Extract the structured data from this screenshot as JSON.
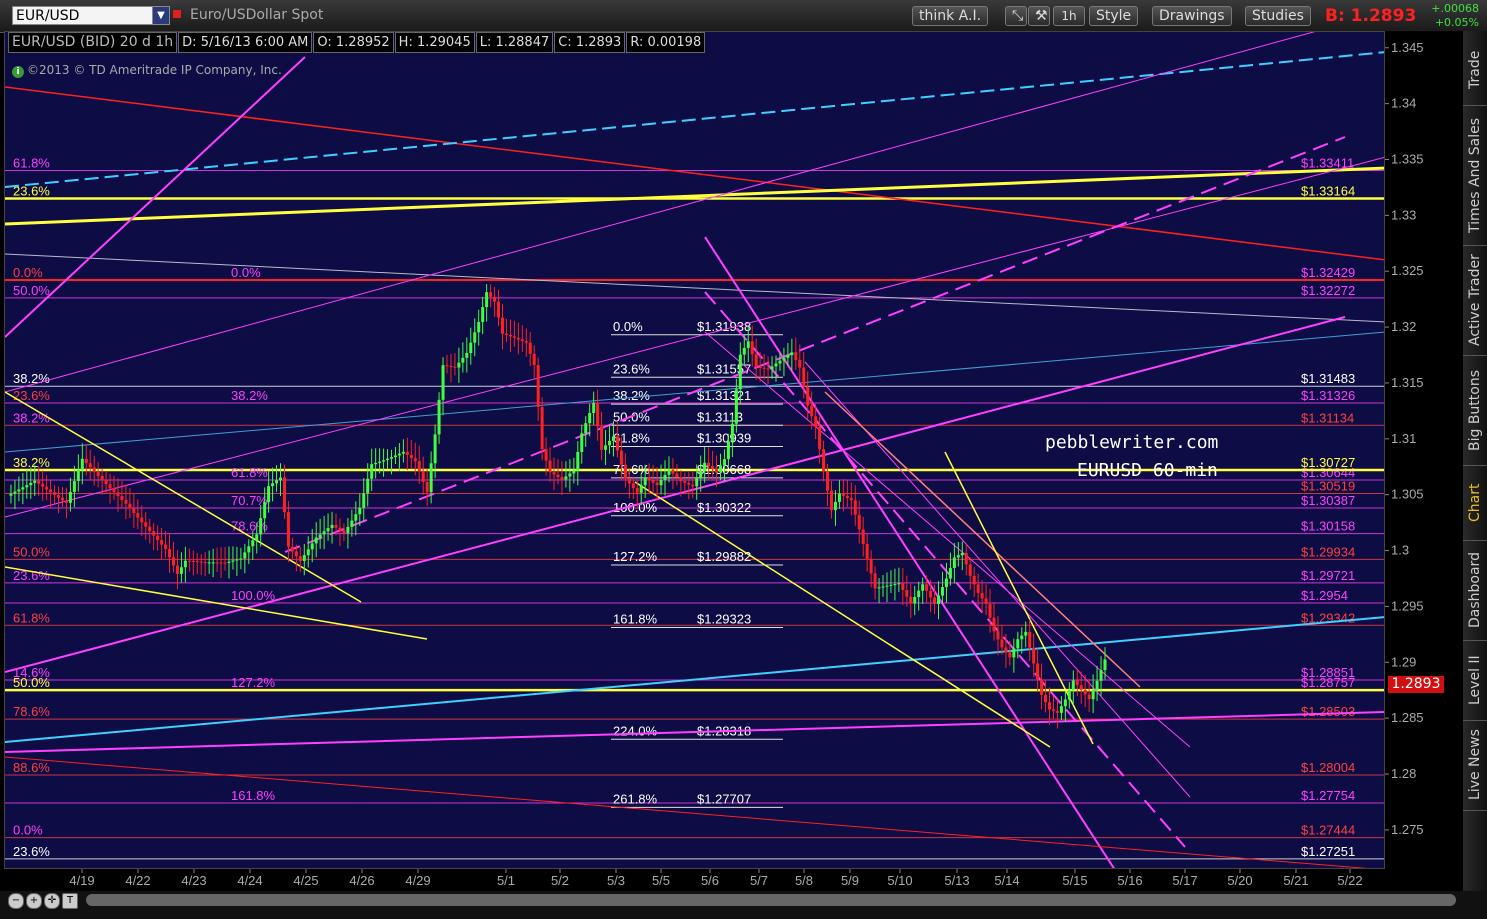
{
  "toolbar": {
    "symbol": "EUR/USD",
    "description": "Euro/USDollar Spot",
    "think_ai": "think A.I.",
    "period": "1h",
    "style": "Style",
    "drawings": "Drawings",
    "studies": "Studies",
    "bid_label": "B: 1.2893",
    "change": "+.00068",
    "change_pct": "+0.05%"
  },
  "header": {
    "title": "EUR/USD (BID) 20 d 1h",
    "date": "D: 5/16/13 6:00 AM",
    "open": "O: 1.28952",
    "high": "H: 1.29045",
    "low": "L: 1.28847",
    "close": "C: 1.2893",
    "range": "R: 0.00198"
  },
  "copyright": "©2013 © TD Ameritrade IP Company, Inc.",
  "side_tabs": [
    "Trade",
    "Times And Sales",
    "Active Trader",
    "Big Buttons",
    "Chart",
    "Dashboard",
    "Level II",
    "Live News"
  ],
  "colors": {
    "background": "#0d0c45",
    "up_candle": "#40ff40",
    "down_candle": "#ff2020",
    "fib_yellow": "#ffff40",
    "fib_magenta": "#ff40ff",
    "fib_red": "#ff4040",
    "cyan": "#40d0ff",
    "white": "#e0e0e0"
  },
  "chart_data": {
    "type": "candlestick",
    "ylim": [
      1.2715,
      1.3465
    ],
    "y_ticks": [
      "1.345",
      "1.34",
      "1.335",
      "1.33",
      "1.325",
      "1.32",
      "1.315",
      "1.31",
      "1.305",
      "1.3",
      "1.295",
      "1.29",
      "1.285",
      "1.28",
      "1.275"
    ],
    "x_ticks": [
      "4/19",
      "4/22",
      "4/23",
      "4/24",
      "4/25",
      "4/26",
      "4/29",
      "5/1",
      "5/2",
      "5/3",
      "5/5",
      "5/6",
      "5/7",
      "5/8",
      "5/9",
      "5/10",
      "5/13",
      "5/14",
      "5/15",
      "5/16",
      "5/17",
      "5/20",
      "5/21",
      "5/22"
    ],
    "last_price": "1.2893",
    "price_path": [
      {
        "x": 0,
        "p": 1.305
      },
      {
        "x": 14,
        "p": 1.307
      },
      {
        "x": 30,
        "p": 1.3055
      },
      {
        "x": 38,
        "p": 1.3095
      },
      {
        "x": 48,
        "p": 1.3075
      },
      {
        "x": 60,
        "p": 1.305
      },
      {
        "x": 70,
        "p": 1.3025
      },
      {
        "x": 80,
        "p": 1.3
      },
      {
        "x": 86,
        "p": 1.2975
      },
      {
        "x": 90,
        "p": 1.2985
      },
      {
        "x": 100,
        "p": 1.298
      },
      {
        "x": 110,
        "p": 1.2978
      },
      {
        "x": 118,
        "p": 1.2982
      },
      {
        "x": 126,
        "p": 1.3005
      },
      {
        "x": 132,
        "p": 1.305
      },
      {
        "x": 138,
        "p": 1.306
      },
      {
        "x": 142,
        "p": 1.3
      },
      {
        "x": 148,
        "p": 1.299
      },
      {
        "x": 156,
        "p": 1.3015
      },
      {
        "x": 164,
        "p": 1.303
      },
      {
        "x": 170,
        "p": 1.3025
      },
      {
        "x": 178,
        "p": 1.305
      },
      {
        "x": 184,
        "p": 1.309
      },
      {
        "x": 192,
        "p": 1.3095
      },
      {
        "x": 200,
        "p": 1.31
      },
      {
        "x": 206,
        "p": 1.309
      },
      {
        "x": 212,
        "p": 1.306
      },
      {
        "x": 216,
        "p": 1.311
      },
      {
        "x": 220,
        "p": 1.317
      },
      {
        "x": 226,
        "p": 1.3165
      },
      {
        "x": 232,
        "p": 1.3175
      },
      {
        "x": 238,
        "p": 1.32
      },
      {
        "x": 242,
        "p": 1.3225
      },
      {
        "x": 246,
        "p": 1.3215
      },
      {
        "x": 250,
        "p": 1.3185
      },
      {
        "x": 256,
        "p": 1.318
      },
      {
        "x": 262,
        "p": 1.3175
      },
      {
        "x": 266,
        "p": 1.3155
      },
      {
        "x": 270,
        "p": 1.308
      },
      {
        "x": 274,
        "p": 1.306
      },
      {
        "x": 280,
        "p": 1.3055
      },
      {
        "x": 286,
        "p": 1.3065
      },
      {
        "x": 290,
        "p": 1.31
      },
      {
        "x": 296,
        "p": 1.313
      },
      {
        "x": 300,
        "p": 1.309
      },
      {
        "x": 306,
        "p": 1.3105
      },
      {
        "x": 312,
        "p": 1.307
      },
      {
        "x": 318,
        "p": 1.306
      },
      {
        "x": 322,
        "p": 1.3075
      },
      {
        "x": 328,
        "p": 1.307
      },
      {
        "x": 334,
        "p": 1.3085
      },
      {
        "x": 340,
        "p": 1.3075
      },
      {
        "x": 346,
        "p": 1.307
      },
      {
        "x": 352,
        "p": 1.309
      },
      {
        "x": 358,
        "p": 1.308
      },
      {
        "x": 362,
        "p": 1.309
      },
      {
        "x": 366,
        "p": 1.312
      },
      {
        "x": 370,
        "p": 1.318
      },
      {
        "x": 374,
        "p": 1.319
      },
      {
        "x": 378,
        "p": 1.3165
      },
      {
        "x": 384,
        "p": 1.316
      },
      {
        "x": 390,
        "p": 1.3165
      },
      {
        "x": 396,
        "p": 1.317
      },
      {
        "x": 400,
        "p": 1.3155
      },
      {
        "x": 404,
        "p": 1.312
      },
      {
        "x": 408,
        "p": 1.31
      },
      {
        "x": 412,
        "p": 1.306
      },
      {
        "x": 416,
        "p": 1.3025
      },
      {
        "x": 420,
        "p": 1.304
      },
      {
        "x": 426,
        "p": 1.3035
      },
      {
        "x": 430,
        "p": 1.301
      },
      {
        "x": 434,
        "p": 1.2985
      },
      {
        "x": 438,
        "p": 1.296
      },
      {
        "x": 444,
        "p": 1.2965
      },
      {
        "x": 450,
        "p": 1.297
      },
      {
        "x": 456,
        "p": 1.2955
      },
      {
        "x": 462,
        "p": 1.2975
      },
      {
        "x": 468,
        "p": 1.296
      },
      {
        "x": 474,
        "p": 1.2985
      },
      {
        "x": 478,
        "p": 1.3005
      },
      {
        "x": 482,
        "p": 1.301
      },
      {
        "x": 486,
        "p": 1.299
      },
      {
        "x": 490,
        "p": 1.2975
      },
      {
        "x": 494,
        "p": 1.2965
      },
      {
        "x": 498,
        "p": 1.294
      },
      {
        "x": 502,
        "p": 1.2925
      },
      {
        "x": 506,
        "p": 1.2915
      },
      {
        "x": 510,
        "p": 1.293
      },
      {
        "x": 514,
        "p": 1.2935
      },
      {
        "x": 518,
        "p": 1.2905
      },
      {
        "x": 522,
        "p": 1.2875
      },
      {
        "x": 526,
        "p": 1.286
      },
      {
        "x": 530,
        "p": 1.2855
      },
      {
        "x": 534,
        "p": 1.2865
      },
      {
        "x": 538,
        "p": 1.288
      },
      {
        "x": 542,
        "p": 1.287
      },
      {
        "x": 546,
        "p": 1.286
      },
      {
        "x": 550,
        "p": 1.2875
      },
      {
        "x": 554,
        "p": 1.2893
      }
    ],
    "fib_right": [
      {
        "label": "$1.33411",
        "value": 1.3341,
        "color": "#ff40ff"
      },
      {
        "label": "$1.33164",
        "value": 1.3316,
        "color": "#ffff40"
      },
      {
        "label": "$1.32429",
        "value": 1.3243,
        "color": "#ff40ff"
      },
      {
        "label": "$1.32272",
        "value": 1.3227,
        "color": "#ff40ff"
      },
      {
        "label": "$1.31483",
        "value": 1.3148,
        "color": "#ffffff"
      },
      {
        "label": "$1.31326",
        "value": 1.3133,
        "color": "#ff40ff"
      },
      {
        "label": "$1.31134",
        "value": 1.3113,
        "color": "#ff4040"
      },
      {
        "label": "$1.30727",
        "value": 1.3073,
        "color": "#ffff40"
      },
      {
        "label": "$1.30644",
        "value": 1.3064,
        "color": "#ff40ff"
      },
      {
        "label": "$1.30519",
        "value": 1.3052,
        "color": "#ff4040"
      },
      {
        "label": "$1.30387",
        "value": 1.3039,
        "color": "#ff40ff"
      },
      {
        "label": "$1.30158",
        "value": 1.3016,
        "color": "#ff40ff"
      },
      {
        "label": "$1.29934",
        "value": 1.2993,
        "color": "#ff4040"
      },
      {
        "label": "$1.29721",
        "value": 1.2972,
        "color": "#ff40ff"
      },
      {
        "label": "$1.2954",
        "value": 1.2954,
        "color": "#ff40ff"
      },
      {
        "label": "$1.29342",
        "value": 1.2934,
        "color": "#ff4040"
      },
      {
        "label": "$1.28851",
        "value": 1.2885,
        "color": "#ff40ff"
      },
      {
        "label": "$1.28757",
        "value": 1.2876,
        "color": "#ff40ff"
      },
      {
        "label": "$1.28503",
        "value": 1.285,
        "color": "#ff4040"
      },
      {
        "label": "$1.28004",
        "value": 1.28,
        "color": "#ff4040"
      },
      {
        "label": "$1.27754",
        "value": 1.2775,
        "color": "#ff40ff"
      },
      {
        "label": "$1.27444",
        "value": 1.2744,
        "color": "#ff4040"
      },
      {
        "label": "$1.27251",
        "value": 1.2725,
        "color": "#ffffff"
      }
    ],
    "fib_mid": [
      {
        "pct": "0.0%",
        "price": "$1.31938",
        "value": 1.3194
      },
      {
        "pct": "23.6%",
        "price": "$1.31557",
        "value": 1.3156
      },
      {
        "pct": "38.2%",
        "price": "$1.31321",
        "value": 1.3132
      },
      {
        "pct": "50.0%",
        "price": "$1.3113",
        "value": 1.3113
      },
      {
        "pct": "61.8%",
        "price": "$1.30939",
        "value": 1.3094
      },
      {
        "pct": "78.6%",
        "price": "$1.30668",
        "value": 1.3066
      },
      {
        "pct": "100.0%",
        "price": "$1.30322",
        "value": 1.3032
      },
      {
        "pct": "127.2%",
        "price": "$1.29882",
        "value": 1.2988
      },
      {
        "pct": "161.8%",
        "price": "$1.29323",
        "value": 1.2932
      },
      {
        "pct": "224.0%",
        "price": "$1.28318",
        "value": 1.2832
      },
      {
        "pct": "261.8%",
        "price": "$1.27707",
        "value": 1.2771
      }
    ],
    "fib_left": [
      {
        "pct": "61.8%",
        "value": 1.3341,
        "color": "#ff40ff"
      },
      {
        "pct": "23.6%",
        "value": 1.3316,
        "color": "#ffff40"
      },
      {
        "pct": "0.0%",
        "value": 1.3243,
        "color": "#ff4040"
      },
      {
        "pct": "50.0%",
        "value": 1.3227,
        "color": "#ff40ff"
      },
      {
        "pct": "38.2%",
        "value": 1.3148,
        "color": "#ffffff"
      },
      {
        "pct": "23.6%",
        "value": 1.3133,
        "color": "#ff4040"
      },
      {
        "pct": "38.2%",
        "value": 1.3113,
        "color": "#ff40ff"
      },
      {
        "pct": "38.2%",
        "value": 1.3073,
        "color": "#ffff40"
      },
      {
        "pct": "50.0%",
        "value": 1.2993,
        "color": "#ff4040"
      },
      {
        "pct": "23.6%",
        "value": 1.2972,
        "color": "#ff40ff"
      },
      {
        "pct": "61.8%",
        "value": 1.2934,
        "color": "#ff4040"
      },
      {
        "pct": "14.6%",
        "value": 1.2885,
        "color": "#ff40ff"
      },
      {
        "pct": "50.0%",
        "value": 1.2876,
        "color": "#ffff40"
      },
      {
        "pct": "78.6%",
        "value": 1.285,
        "color": "#ff4040"
      },
      {
        "pct": "88.6%",
        "value": 1.28,
        "color": "#ff4040"
      },
      {
        "pct": "0.0%",
        "value": 1.2744,
        "color": "#ff40ff"
      },
      {
        "pct": "23.6%",
        "value": 1.2725,
        "color": "#ffffff"
      }
    ],
    "fib_second": [
      {
        "pct": "0.0%",
        "value": 1.3243
      },
      {
        "pct": "38.2%",
        "value": 1.3133
      },
      {
        "pct": "61.8%",
        "value": 1.3064
      },
      {
        "pct": "70.7%",
        "value": 1.3039
      },
      {
        "pct": "78.6%",
        "value": 1.3016
      },
      {
        "pct": "100.0%",
        "value": 1.2954
      },
      {
        "pct": "127.2%",
        "value": 1.2876
      },
      {
        "pct": "161.8%",
        "value": 1.2775
      }
    ],
    "annotations": [
      "pebblewriter.com",
      "EURUSD 60-min"
    ]
  }
}
